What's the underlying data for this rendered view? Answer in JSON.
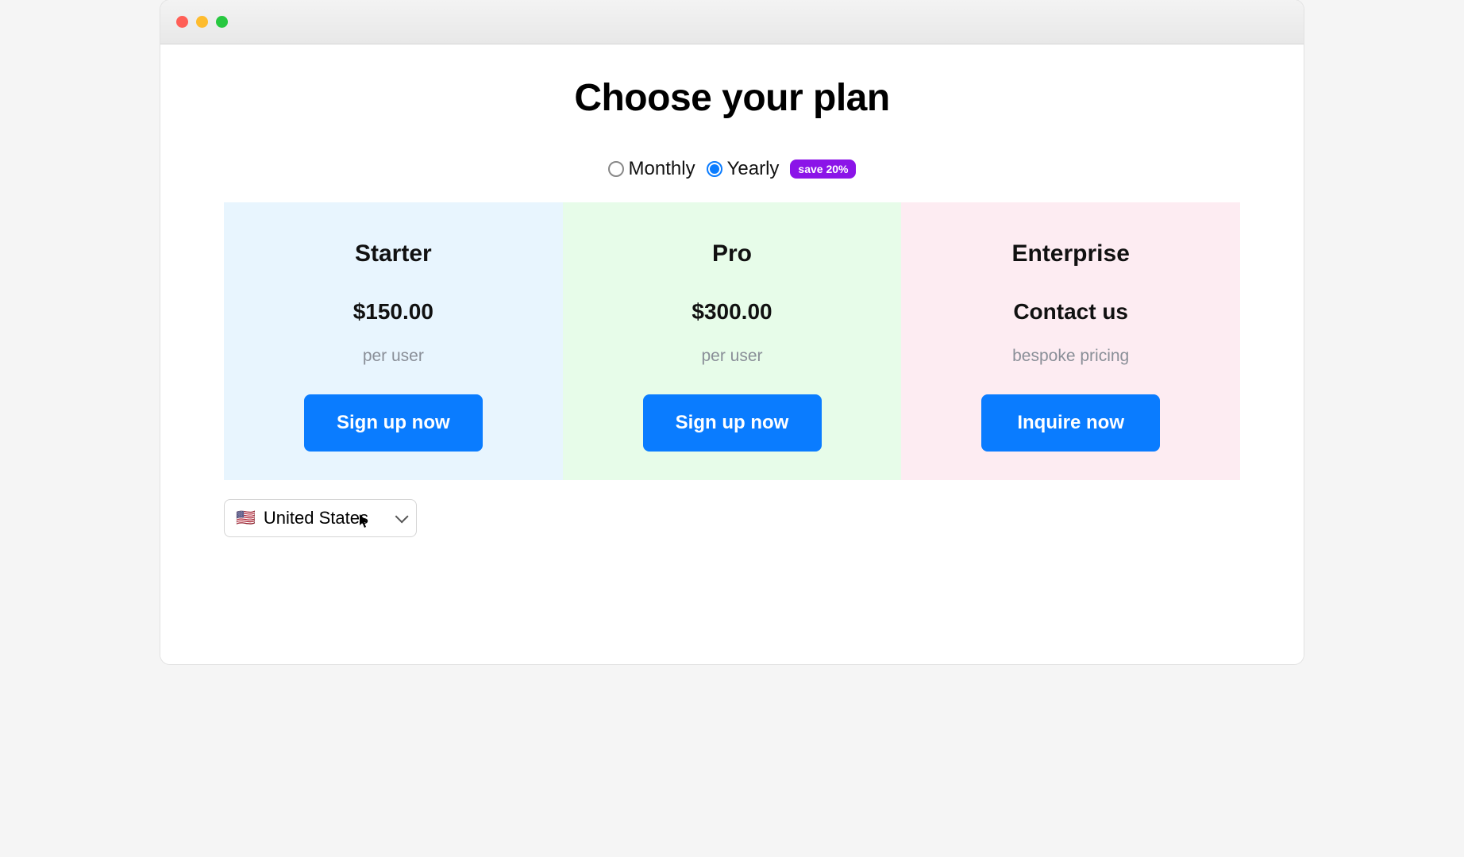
{
  "heading": "Choose your plan",
  "period": {
    "monthly": {
      "label": "Monthly",
      "selected": false
    },
    "yearly": {
      "label": "Yearly",
      "selected": true
    },
    "badge": "save 20%"
  },
  "plans": [
    {
      "name": "Starter",
      "price": "$150.00",
      "sub": "per user",
      "cta": "Sign up now"
    },
    {
      "name": "Pro",
      "price": "$300.00",
      "sub": "per user",
      "cta": "Sign up now"
    },
    {
      "name": "Enterprise",
      "price": "Contact us",
      "sub": "bespoke pricing",
      "cta": "Inquire now"
    }
  ],
  "country": {
    "flag": "🇺🇸",
    "label": "United States"
  }
}
